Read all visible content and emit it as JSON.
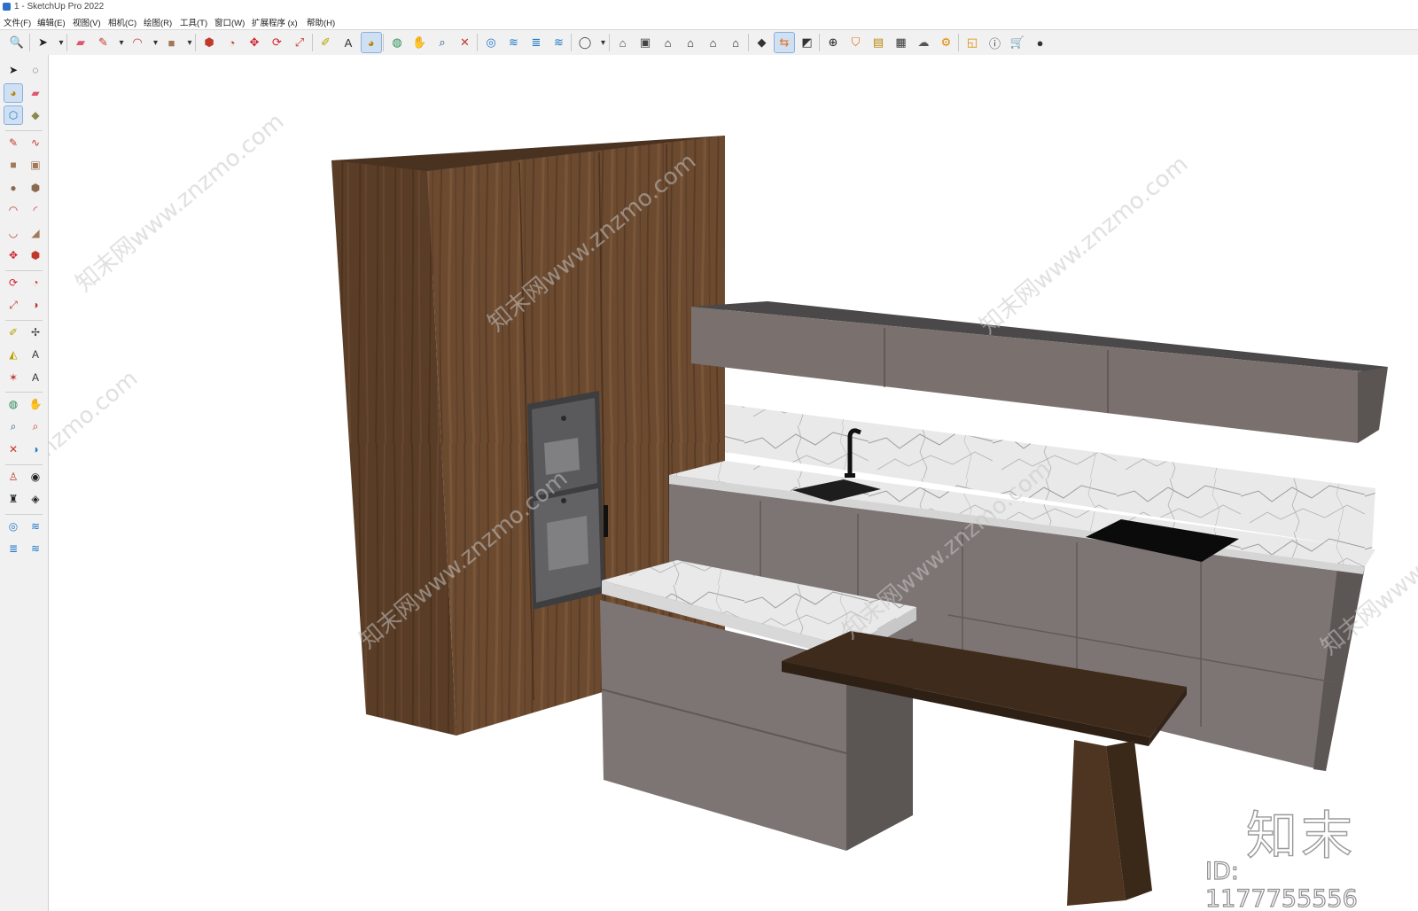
{
  "window": {
    "title": "1 - SketchUp Pro 2022"
  },
  "menu": [
    "文件(F)",
    "编辑(E)",
    "视图(V)",
    "相机(C)",
    "绘图(R)",
    "工具(T)",
    "窗口(W)",
    "扩展程序 (x)",
    "帮助(H)"
  ],
  "toolbar": [
    {
      "name": "search-icon",
      "glyph": "🔍",
      "color": "#333333"
    },
    {
      "name": "select-icon",
      "glyph": "➤",
      "color": "#222222"
    },
    {
      "name": "dropdown-icon",
      "glyph": "▾",
      "color": "#333333"
    },
    {
      "name": "eraser-icon",
      "glyph": "▰",
      "color": "#e0566e"
    },
    {
      "name": "pencil-icon",
      "glyph": "✎",
      "color": "#c0392b"
    },
    {
      "name": "dropdown-icon",
      "glyph": "▾",
      "color": "#333333"
    },
    {
      "name": "arc-icon",
      "glyph": "◠",
      "color": "#c0392b"
    },
    {
      "name": "dropdown-icon",
      "glyph": "▾",
      "color": "#333333"
    },
    {
      "name": "rectangle-icon",
      "glyph": "■",
      "color": "#a0785a"
    },
    {
      "name": "dropdown-icon",
      "glyph": "▾",
      "color": "#333333"
    },
    {
      "name": "push-pull-icon",
      "glyph": "⬢",
      "color": "#c0392b"
    },
    {
      "name": "follow-me-icon",
      "glyph": "◔",
      "color": "#c0392b"
    },
    {
      "name": "move-icon",
      "glyph": "✥",
      "color": "#d0222a"
    },
    {
      "name": "rotate-icon",
      "glyph": "⟳",
      "color": "#d0222a"
    },
    {
      "name": "scale-icon",
      "glyph": "⤢",
      "color": "#c0392b"
    },
    {
      "name": "tape-measure-icon",
      "glyph": "✐",
      "color": "#b8a200"
    },
    {
      "name": "text-label-icon",
      "glyph": "A",
      "color": "#333333"
    },
    {
      "name": "paint-bucket-icon",
      "glyph": "◕",
      "color": "#b8860b"
    },
    {
      "name": "orbit-icon",
      "glyph": "◍",
      "color": "#2e8b57"
    },
    {
      "name": "pan-icon",
      "glyph": "✋",
      "color": "#caa064"
    },
    {
      "name": "zoom-icon",
      "glyph": "⌕",
      "color": "#1f4f8f"
    },
    {
      "name": "zoom-extents-icon",
      "glyph": "✕",
      "color": "#c0392b"
    },
    {
      "name": "warehouse-icon",
      "glyph": "◎",
      "color": "#1f78c8"
    },
    {
      "name": "extension-warehouse-icon",
      "glyph": "≋",
      "color": "#1f78c8"
    },
    {
      "name": "layout-icon",
      "glyph": "≣",
      "color": "#1f78c8"
    },
    {
      "name": "style-builder-icon",
      "glyph": "≋",
      "color": "#1f78c8"
    },
    {
      "name": "user-account-icon",
      "glyph": "◯",
      "color": "#444444"
    },
    {
      "name": "dropdown-icon",
      "glyph": "▾",
      "color": "#333333"
    },
    {
      "name": "iso-view-icon",
      "glyph": "⌂",
      "color": "#444444"
    },
    {
      "name": "top-view-icon",
      "glyph": "▣",
      "color": "#444444"
    },
    {
      "name": "front-view-icon",
      "glyph": "⌂",
      "color": "#222222"
    },
    {
      "name": "right-view-icon",
      "glyph": "⌂",
      "color": "#222222"
    },
    {
      "name": "back-view-icon",
      "glyph": "⌂",
      "color": "#222222"
    },
    {
      "name": "left-view-icon",
      "glyph": "⌂",
      "color": "#222222"
    },
    {
      "name": "solid-tools-icon",
      "glyph": "◆",
      "color": "#333333"
    },
    {
      "name": "section-plane-icon",
      "glyph": "⇆",
      "color": "#e07020"
    },
    {
      "name": "scenes-icon",
      "glyph": "◩",
      "color": "#333333"
    },
    {
      "name": "add-location-icon",
      "glyph": "⊕",
      "color": "#222222"
    },
    {
      "name": "shield-icon",
      "glyph": "⛉",
      "color": "#e07020"
    },
    {
      "name": "materials-icon",
      "glyph": "▤",
      "color": "#b8860b"
    },
    {
      "name": "checker-icon",
      "glyph": "▦",
      "color": "#333333"
    },
    {
      "name": "cloud-icon",
      "glyph": "☁",
      "color": "#555555"
    },
    {
      "name": "settings-gear-icon",
      "glyph": "⚙",
      "color": "#e08a00"
    },
    {
      "name": "folder-icon",
      "glyph": "◱",
      "color": "#e08a00"
    },
    {
      "name": "info-icon",
      "glyph": "ⓘ",
      "color": "#444444"
    },
    {
      "name": "cart-icon",
      "glyph": "🛒",
      "color": "#333333"
    },
    {
      "name": "profile-icon",
      "glyph": "●",
      "color": "#333333"
    }
  ],
  "side_tools": [
    {
      "name": "select-icon",
      "glyph": "➤",
      "color": "#222222"
    },
    {
      "name": "lasso-icon",
      "glyph": "◌",
      "color": "#222222"
    },
    {
      "name": "paint-bucket-icon",
      "glyph": "◕",
      "color": "#b8860b"
    },
    {
      "name": "eraser-icon",
      "glyph": "▰",
      "color": "#e0566e"
    },
    {
      "name": "component-icon",
      "glyph": "⬡",
      "color": "#1f78c8"
    },
    {
      "name": "tag-icon",
      "glyph": "◆",
      "color": "#8a8a50"
    },
    {
      "name": "pencil-icon",
      "glyph": "✎",
      "color": "#c0392b"
    },
    {
      "name": "freehand-icon",
      "glyph": "∿",
      "color": "#c0392b"
    },
    {
      "name": "rectangle-icon",
      "glyph": "■",
      "color": "#a0785a"
    },
    {
      "name": "rotated-rectangle-icon",
      "glyph": "▣",
      "color": "#a0785a"
    },
    {
      "name": "circle-icon",
      "glyph": "●",
      "color": "#8a6a50"
    },
    {
      "name": "polygon-icon",
      "glyph": "⬢",
      "color": "#8a6a50"
    },
    {
      "name": "arc-icon",
      "glyph": "◠",
      "color": "#c0392b"
    },
    {
      "name": "two-point-arc-icon",
      "glyph": "◜",
      "color": "#c0392b"
    },
    {
      "name": "three-point-arc-icon",
      "glyph": "◡",
      "color": "#c0392b"
    },
    {
      "name": "pie-icon",
      "glyph": "◢",
      "color": "#a0785a"
    },
    {
      "name": "move-icon",
      "glyph": "✥",
      "color": "#d0222a"
    },
    {
      "name": "push-pull-icon",
      "glyph": "⬢",
      "color": "#c0392b"
    },
    {
      "name": "rotate-icon",
      "glyph": "⟳",
      "color": "#d0222a"
    },
    {
      "name": "follow-me-icon",
      "glyph": "◔",
      "color": "#c0392b"
    },
    {
      "name": "scale-icon",
      "glyph": "⤢",
      "color": "#c0392b"
    },
    {
      "name": "offset-icon",
      "glyph": "◑",
      "color": "#c0392b"
    },
    {
      "name": "tape-measure-icon",
      "glyph": "✐",
      "color": "#b8a200"
    },
    {
      "name": "dimension-icon",
      "glyph": "✢",
      "color": "#333333"
    },
    {
      "name": "protractor-icon",
      "glyph": "◭",
      "color": "#b8a200"
    },
    {
      "name": "text-icon",
      "glyph": "A",
      "color": "#333333"
    },
    {
      "name": "axes-icon",
      "glyph": "✶",
      "color": "#c0392b"
    },
    {
      "name": "3d-text-icon",
      "glyph": "A",
      "color": "#333333"
    },
    {
      "name": "orbit-icon",
      "glyph": "◍",
      "color": "#2e8b57"
    },
    {
      "name": "pan-icon",
      "glyph": "✋",
      "color": "#caa064"
    },
    {
      "name": "zoom-icon",
      "glyph": "⌕",
      "color": "#1f4f8f"
    },
    {
      "name": "zoom-window-icon",
      "glyph": "⌕",
      "color": "#c0392b"
    },
    {
      "name": "zoom-extents-icon",
      "glyph": "✕",
      "color": "#c0392b"
    },
    {
      "name": "previous-view-icon",
      "glyph": "◑",
      "color": "#1f78c8"
    },
    {
      "name": "position-camera-icon",
      "glyph": "♙",
      "color": "#c0392b"
    },
    {
      "name": "look-around-icon",
      "glyph": "◉",
      "color": "#222222"
    },
    {
      "name": "walk-icon",
      "glyph": "♜",
      "color": "#222222"
    },
    {
      "name": "section-plane-icon",
      "glyph": "◈",
      "color": "#222222"
    },
    {
      "name": "warehouse-icon",
      "glyph": "◎",
      "color": "#1f78c8"
    },
    {
      "name": "extension-warehouse-icon",
      "glyph": "≋",
      "color": "#1f78c8"
    },
    {
      "name": "layout-icon",
      "glyph": "≣",
      "color": "#1f78c8"
    },
    {
      "name": "style-builder-icon",
      "glyph": "≋",
      "color": "#1f78c8"
    }
  ],
  "watermark": "知末网www.znzmo.com",
  "brand": "知末",
  "model_id": "ID: 1177755556"
}
